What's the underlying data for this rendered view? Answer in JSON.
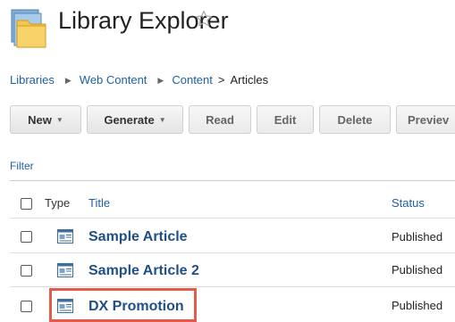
{
  "header": {
    "title": "Library Explorer",
    "icon": "folder-icon",
    "favorite_icon": "star-outline-icon"
  },
  "breadcrumb": {
    "items": [
      "Libraries",
      "Web Content",
      "Content"
    ],
    "current": "Articles",
    "separator_final": ">"
  },
  "toolbar": {
    "buttons": [
      {
        "label": "New",
        "has_dropdown": true,
        "enabled": true
      },
      {
        "label": "Generate",
        "has_dropdown": true,
        "enabled": true
      },
      {
        "label": "Read",
        "has_dropdown": false,
        "enabled": false
      },
      {
        "label": "Edit",
        "has_dropdown": false,
        "enabled": false
      },
      {
        "label": "Delete",
        "has_dropdown": false,
        "enabled": false
      },
      {
        "label": "Previev",
        "has_dropdown": false,
        "enabled": false
      }
    ]
  },
  "filter": {
    "label": "Filter"
  },
  "table": {
    "columns": {
      "type": "Type",
      "title": "Title",
      "status": "Status"
    },
    "rows": [
      {
        "title": "Sample Article",
        "status": "Published",
        "icon": "article-document-icon"
      },
      {
        "title": "Sample Article 2",
        "status": "Published",
        "icon": "article-document-icon"
      },
      {
        "title": "DX Promotion",
        "status": "Published",
        "icon": "article-document-icon",
        "highlighted": true
      }
    ]
  },
  "colors": {
    "link": "#1f5fa5",
    "title_link": "#1f4f86",
    "highlight": "#e25b4b"
  }
}
